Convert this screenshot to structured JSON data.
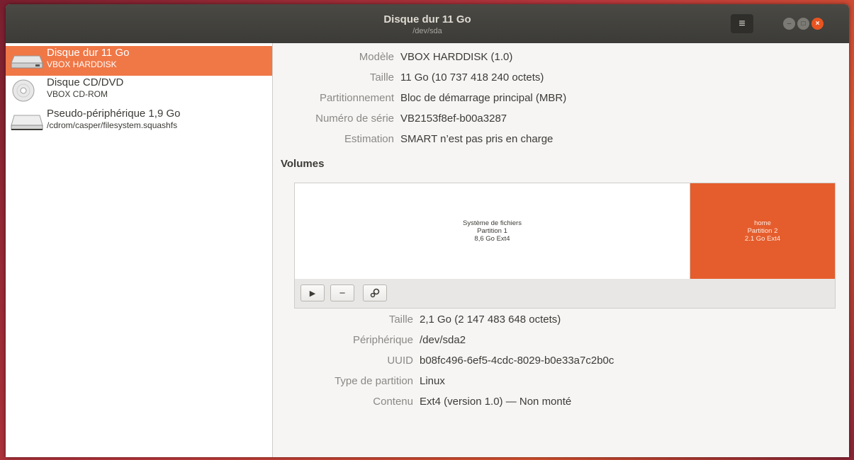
{
  "window": {
    "title": "Disque dur 11 Go",
    "subtitle": "/dev/sda",
    "menu_icon": "hamburger-icon",
    "controls": [
      "minimize-icon",
      "maximize-icon",
      "close-icon"
    ]
  },
  "sidebar": {
    "drives": [
      {
        "name": "Disque dur 11 Go",
        "sub": "VBOX HARDDISK",
        "icon": "harddisk-icon",
        "selected": true
      },
      {
        "name": "Disque CD/DVD",
        "sub": "VBOX CD-ROM",
        "icon": "optical-disc-icon",
        "selected": false
      },
      {
        "name": "Pseudo-périphérique 1,9 Go",
        "sub": "/cdrom/casper/filesystem.squashfs",
        "icon": "loop-device-icon",
        "selected": false
      }
    ]
  },
  "disk_props": [
    {
      "label": "Modèle",
      "value": "VBOX HARDDISK (1.0)"
    },
    {
      "label": "Taille",
      "value": "11 Go (10 737 418 240 octets)"
    },
    {
      "label": "Partitionnement",
      "value": "Bloc de démarrage principal (MBR)"
    },
    {
      "label": "Numéro de série",
      "value": "VB2153f8ef-b00a3287"
    },
    {
      "label": "Estimation",
      "value": "SMART n’est pas pris en charge"
    }
  ],
  "volumes": {
    "heading": "Volumes",
    "partitions": [
      {
        "line1": "Système de fichiers",
        "line2": "Partition 1",
        "line3": "8,6 Go Ext4",
        "selected": false
      },
      {
        "line1": "home",
        "line2": "Partition 2",
        "line3": "2.1 Go Ext4",
        "selected": true
      }
    ],
    "toolbar": [
      "play-icon",
      "minus-icon",
      "gears-icon"
    ]
  },
  "volume_props": [
    {
      "label": "Taille",
      "value": "2,1 Go (2 147 483 648 octets)"
    },
    {
      "label": "Périphérique",
      "value": "/dev/sda2"
    },
    {
      "label": "UUID",
      "value": "b08fc496-6ef5-4cdc-8029-b0e33a7c2b0c"
    },
    {
      "label": "Type de partition",
      "value": "Linux"
    },
    {
      "label": "Contenu",
      "value": "Ext4 (version 1.0) — Non monté"
    }
  ],
  "colors": {
    "accent": "#e95420",
    "selection": "#f07746",
    "titlebar": "#3c3b37"
  }
}
